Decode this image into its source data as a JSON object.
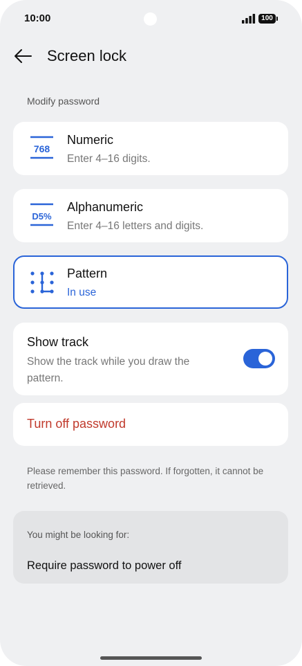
{
  "status_bar": {
    "time": "10:00",
    "battery": "100",
    "icons": [
      "signal-icon",
      "battery-icon"
    ]
  },
  "header": {
    "title": "Screen lock",
    "back_icon": "back-arrow-icon"
  },
  "section": {
    "label": "Modify password"
  },
  "options": [
    {
      "icon_text": "768",
      "icon": "numeric-icon",
      "title": "Numeric",
      "subtitle": "Enter 4–16 digits.",
      "selected": false
    },
    {
      "icon_text": "D5%",
      "icon": "alphanumeric-icon",
      "title": "Alphanumeric",
      "subtitle": "Enter 4–16 letters and digits.",
      "selected": false
    },
    {
      "icon": "pattern-icon",
      "title": "Pattern",
      "subtitle": "In use",
      "selected": true
    }
  ],
  "show_track": {
    "title": "Show track",
    "description": "Show the track while you draw the pattern.",
    "enabled": true
  },
  "turn_off": {
    "label": "Turn off password"
  },
  "note": "Please remember this password. If forgotten, it cannot be retrieved.",
  "suggestions": {
    "header": "You might be looking for:",
    "items": [
      "Require password to power off"
    ]
  },
  "colors": {
    "accent": "#2a64d8",
    "danger": "#c0392b",
    "background": "#eff0f2",
    "card": "#ffffff"
  }
}
